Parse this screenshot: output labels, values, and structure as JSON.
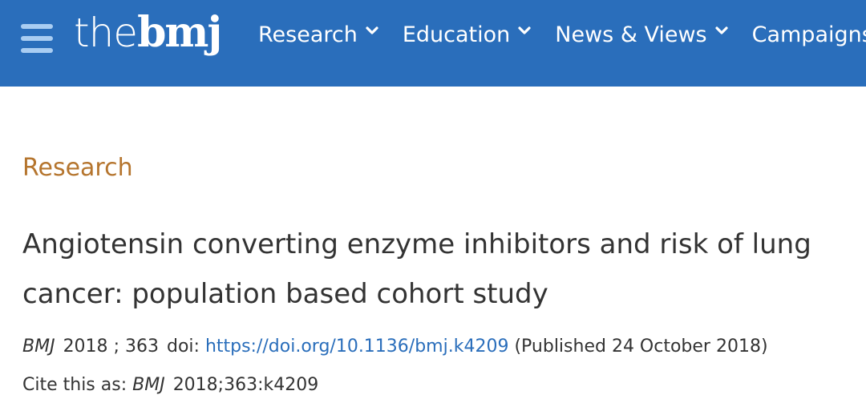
{
  "colors": {
    "navbar_background": "#2a6ebb",
    "hamburger": "#a9cdf2",
    "section_label": "#b5752e",
    "link": "#2a6ebb",
    "text": "#333333"
  },
  "header": {
    "logo_the": "the",
    "logo_bmj": "bmj",
    "menu_icon": "hamburger-menu-icon",
    "nav": [
      {
        "label": "Research",
        "icon": "chevron-down-icon"
      },
      {
        "label": "Education",
        "icon": "chevron-down-icon"
      },
      {
        "label": "News & Views",
        "icon": "chevron-down-icon"
      },
      {
        "label": "Campaigns",
        "icon": null
      }
    ]
  },
  "article": {
    "section": "Research",
    "title": "Angiotensin converting enzyme inhibitors and risk of lung cancer: population based cohort study",
    "journal": "BMJ",
    "year": "2018",
    "separator": ";",
    "volume": "363",
    "doi_label": "doi:",
    "doi_url": "https://doi.org/10.1136/bmj.k4209",
    "published": "(Published 24 October 2018)",
    "cite_label": "Cite this as:",
    "cite_journal": "BMJ",
    "cite_ref": "2018;363:k4209"
  }
}
